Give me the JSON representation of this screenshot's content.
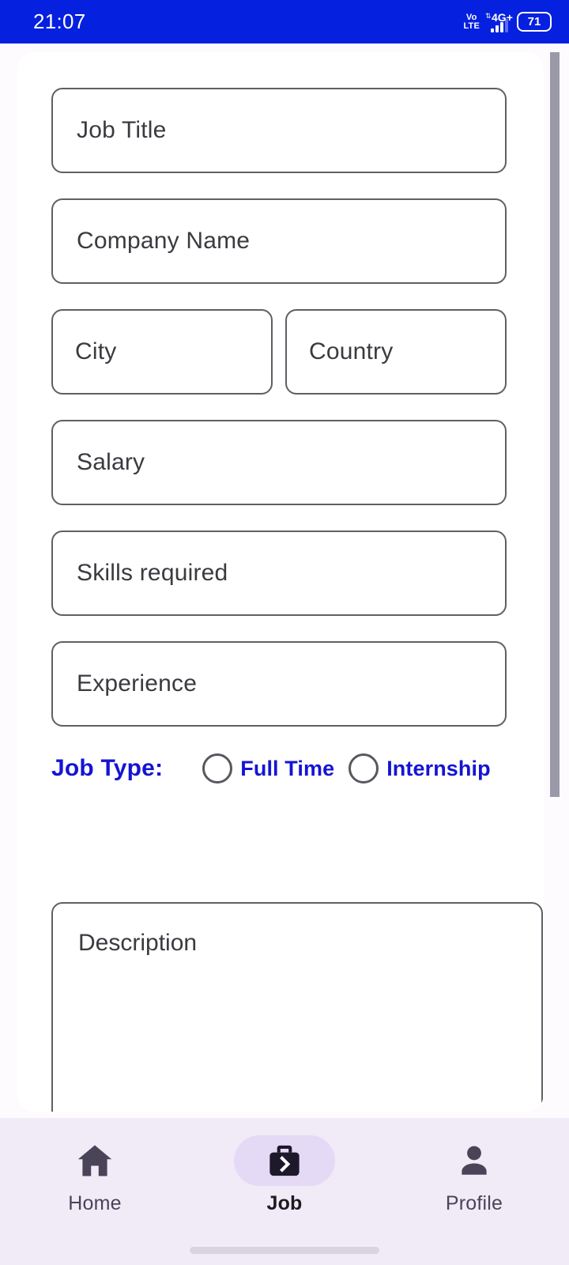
{
  "status_bar": {
    "time": "21:07",
    "volte_top": "Vo",
    "volte_bottom": "LTE",
    "network_type": "4G",
    "network_plus": "+",
    "data_arrows": "⇅",
    "battery_level": "71",
    "background_color": "#0620df",
    "foreground_color": "#ffffff"
  },
  "form": {
    "fields": [
      {
        "name": "job-title",
        "placeholder": "Job Title"
      },
      {
        "name": "company-name",
        "placeholder": "Company Name"
      },
      {
        "name": "city",
        "placeholder": "City"
      },
      {
        "name": "country",
        "placeholder": "Country"
      },
      {
        "name": "salary",
        "placeholder": "Salary"
      },
      {
        "name": "skills-required",
        "placeholder": "Skills required"
      },
      {
        "name": "experience",
        "placeholder": "Experience"
      }
    ],
    "job_type": {
      "label": "Job Type:",
      "accent_color": "#1414d4",
      "options": [
        {
          "label": "Full Time",
          "selected": false
        },
        {
          "label": "Internship",
          "selected": false
        }
      ]
    },
    "description": {
      "placeholder": "Description"
    }
  },
  "bottom_nav": {
    "background_color": "#f1eaf7",
    "items": [
      {
        "label": "Home",
        "icon": "home-icon",
        "active": false
      },
      {
        "label": "Job",
        "icon": "briefcase-chevron-icon",
        "active": true
      },
      {
        "label": "Profile",
        "icon": "person-icon",
        "active": false
      }
    ]
  },
  "scrollbar": {
    "color": "#9a99a8"
  }
}
